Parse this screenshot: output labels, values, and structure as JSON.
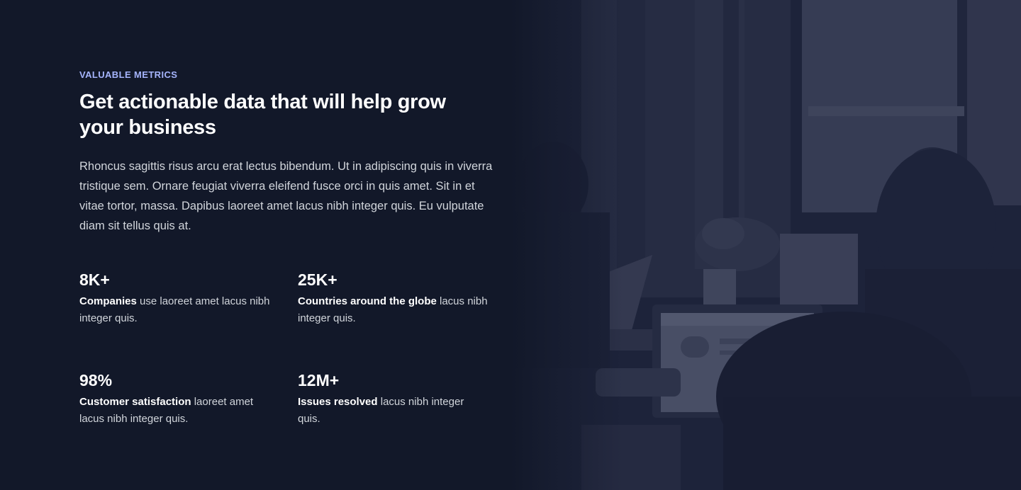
{
  "section": {
    "eyebrow": "Valuable Metrics",
    "headline": "Get actionable data that will help grow your business",
    "description": "Rhoncus sagittis risus arcu erat lectus bibendum. Ut in adipiscing quis in viverra tristique sem. Ornare feugiat viverra eleifend fusce orci in quis amet. Sit in et vitae tortor, massa. Dapibus laoreet amet lacus nibh integer quis. Eu vulputate diam sit tellus quis at."
  },
  "stats": [
    {
      "value": "8K+",
      "label": "Companies",
      "text": " use laoreet amet lacus nibh integer quis."
    },
    {
      "value": "25K+",
      "label": "Countries around the globe",
      "text": " lacus nibh integer quis."
    },
    {
      "value": "98%",
      "label": "Customer satisfaction",
      "text": " laoreet amet lacus nibh integer quis."
    },
    {
      "value": "12M+",
      "label": "Issues resolved",
      "text": " lacus nibh integer quis."
    }
  ],
  "image": {
    "subject": "people working on laptops in an office",
    "tint": "#1f2540"
  },
  "colors": {
    "background": "#121829",
    "eyebrow": "#a5b4fc",
    "heading": "#ffffff",
    "body": "#d1d5db"
  }
}
